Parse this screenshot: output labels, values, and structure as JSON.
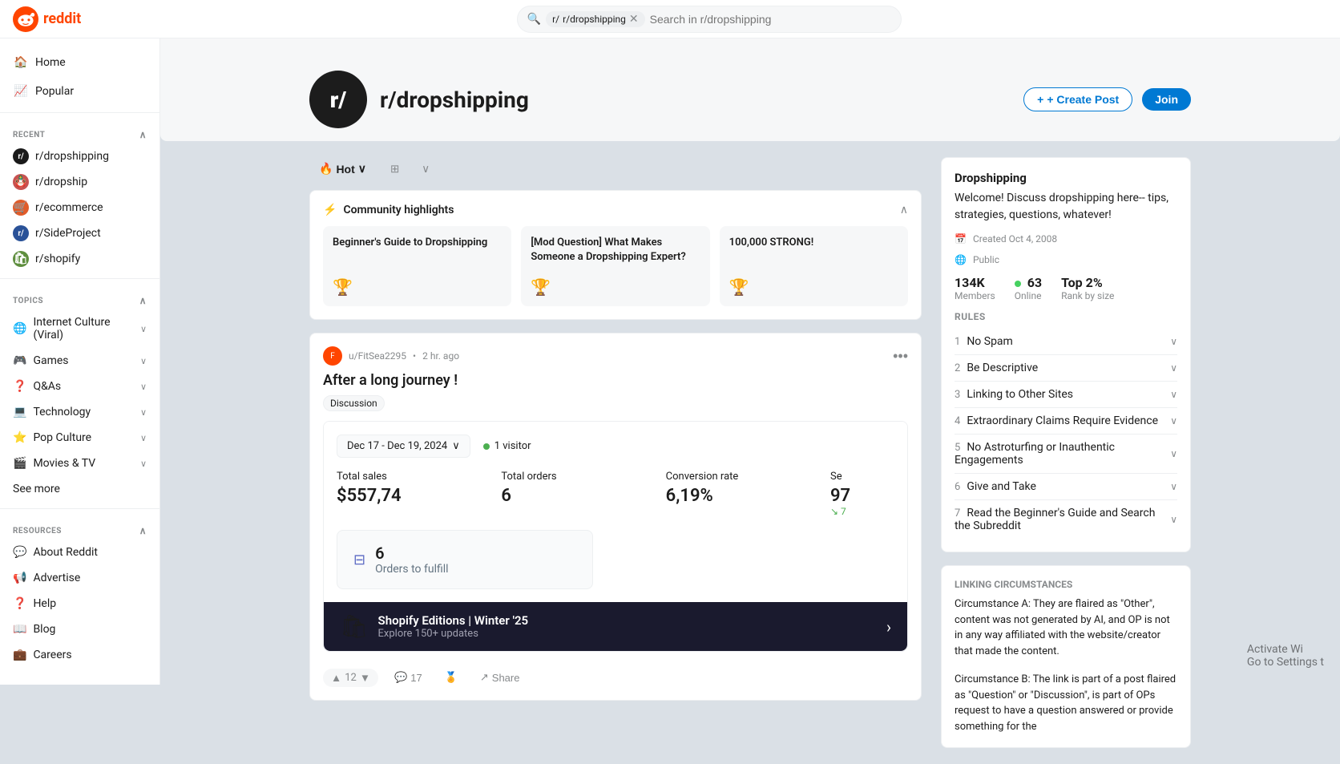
{
  "brand": {
    "name": "reddit",
    "logo_color": "#ff4500"
  },
  "nav": {
    "search_placeholder": "Search in r/dropshipping",
    "search_chip_label": "r/dropshipping",
    "search_chip_icon": "r/"
  },
  "sidebar": {
    "home_label": "Home",
    "popular_label": "Popular",
    "recent_section": "RECENT",
    "recent_items": [
      {
        "label": "r/dropshipping",
        "color": "#1a1a1a",
        "prefix": "r/"
      },
      {
        "label": "r/dropship",
        "color": "#c85250",
        "prefix": "🪆"
      },
      {
        "label": "r/ecommerce",
        "color": "#e05c2a",
        "prefix": "🛒"
      },
      {
        "label": "r/SideProject",
        "color": "#2a5298",
        "prefix": "r/"
      },
      {
        "label": "r/shopify",
        "color": "#5e8e3e",
        "prefix": "🛍"
      }
    ],
    "topics_section": "TOPICS",
    "topics_items": [
      {
        "label": "Internet Culture (Viral)"
      },
      {
        "label": "Games"
      },
      {
        "label": "Q&As"
      },
      {
        "label": "Technology"
      },
      {
        "label": "Pop Culture"
      },
      {
        "label": "Movies & TV"
      }
    ],
    "see_more": "See more",
    "resources_section": "RESOURCES",
    "resources_items": [
      {
        "label": "About Reddit"
      },
      {
        "label": "Advertise"
      },
      {
        "label": "Help"
      },
      {
        "label": "Blog"
      },
      {
        "label": "Careers"
      }
    ]
  },
  "subreddit": {
    "name": "r/dropshipping",
    "icon_text": "r/",
    "create_post_label": "+ Create Post",
    "join_label": "Join"
  },
  "feed": {
    "sort_label": "Hot",
    "community_highlights_label": "Community highlights",
    "highlights": [
      {
        "title": "Beginner's Guide to Dropshipping",
        "emoji": "🏆"
      },
      {
        "title": "[Mod Question] What Makes Someone a Dropshipping Expert?",
        "emoji": "🏆"
      },
      {
        "title": "100,000 STRONG!",
        "emoji": "🏆"
      }
    ]
  },
  "post": {
    "user": "u/FitSea2295",
    "time_ago": "2 hr. ago",
    "title": "After a long journey !",
    "tag": "Discussion",
    "menu_icon": "•••",
    "dashboard": {
      "date_range": "Dec 17 - Dec 19, 2024",
      "visitors": "1 visitor",
      "stats": [
        {
          "label": "Total sales",
          "value": "$557,74"
        },
        {
          "label": "Total orders",
          "value": "6"
        },
        {
          "label": "Conversion rate",
          "value": "6,19%"
        },
        {
          "label": "Se",
          "value": "97",
          "arrow": "↘ 7"
        }
      ],
      "fulfill_count": "6",
      "fulfill_label": "Orders to fulfill"
    },
    "shopify_banner": {
      "title": "Shopify Editions | Winter '25",
      "subtitle": "Explore 150+ updates"
    },
    "actions": {
      "upvote": "12",
      "downvote": "",
      "comments": "17",
      "award_icon": "🏅",
      "share_label": "Share"
    }
  },
  "right_sidebar": {
    "title": "Dropshipping",
    "description": "Welcome! Discuss dropshipping here-- tips, strategies, questions, whatever!",
    "created": "Created Oct 4, 2008",
    "visibility": "Public",
    "members": "134K",
    "members_label": "Members",
    "online": "63",
    "online_label": "Online",
    "rank": "Top 2%",
    "rank_label": "Rank by size",
    "rules_title": "RULES",
    "rules": [
      {
        "num": "1",
        "text": "No Spam"
      },
      {
        "num": "2",
        "text": "Be Descriptive"
      },
      {
        "num": "3",
        "text": "Linking to Other Sites"
      },
      {
        "num": "4",
        "text": "Extraordinary Claims Require Evidence"
      },
      {
        "num": "5",
        "text": "No Astroturfing or Inauthentic Engagements"
      },
      {
        "num": "6",
        "text": "Give and Take"
      },
      {
        "num": "7",
        "text": "Read the Beginner's Guide and Search the Subreddit"
      }
    ],
    "linking_title": "LINKING CIRCUMSTANCES",
    "linking_a": "Circumstance A: They are flaired as \"Other\", content was not generated by AI, and OP is not in any way affiliated with the website/creator that made the content.",
    "linking_b": "Circumstance B: The link is part of a post flaired as \"Question\" or \"Discussion\", is part of OPs request to have a question answered or provide something for the"
  },
  "watermark": {
    "line1": "Activate Wi",
    "line2": "Go to Settings t"
  }
}
